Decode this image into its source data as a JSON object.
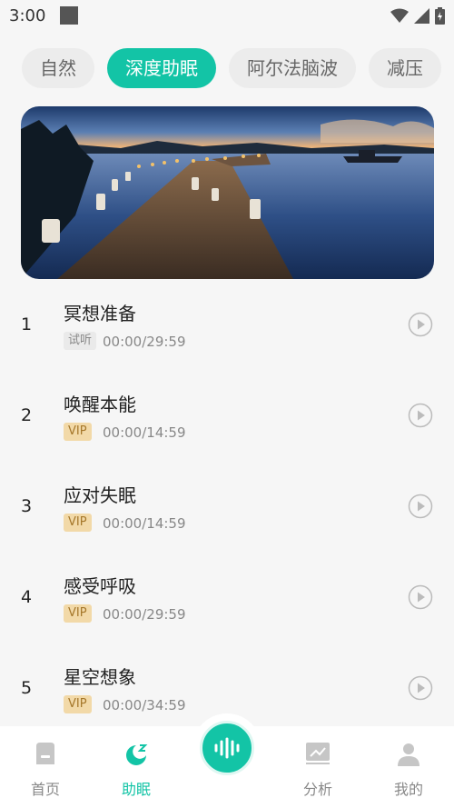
{
  "status_bar": {
    "time": "3:00"
  },
  "tabs": [
    {
      "label": "自然",
      "active": false
    },
    {
      "label": "深度助眠",
      "active": true
    },
    {
      "label": "阿尔法脑波",
      "active": false
    },
    {
      "label": "减压",
      "active": false
    }
  ],
  "tracks": [
    {
      "num": "1",
      "title": "冥想准备",
      "badge": "试听",
      "badge_type": "trial",
      "time": "00:00/29:59"
    },
    {
      "num": "2",
      "title": "唤醒本能",
      "badge": "VIP",
      "badge_type": "vip",
      "time": "00:00/14:59"
    },
    {
      "num": "3",
      "title": "应对失眠",
      "badge": "VIP",
      "badge_type": "vip",
      "time": "00:00/14:59"
    },
    {
      "num": "4",
      "title": "感受呼吸",
      "badge": "VIP",
      "badge_type": "vip",
      "time": "00:00/29:59"
    },
    {
      "num": "5",
      "title": "星空想象",
      "badge": "VIP",
      "badge_type": "vip",
      "time": "00:00/34:59"
    }
  ],
  "bottom_nav": {
    "home": "首页",
    "sleep": "助眠",
    "analysis": "分析",
    "mine": "我的"
  },
  "colors": {
    "accent": "#13c4a6",
    "vip_bg": "#f2d9a8"
  }
}
